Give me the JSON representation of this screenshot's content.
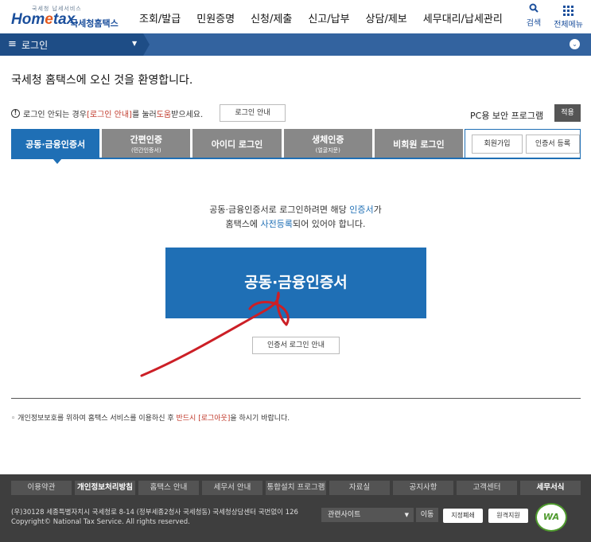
{
  "header": {
    "logo_tagline": "국세청 납세서비스",
    "logo_brand_a": "Hom",
    "logo_brand_e": "e",
    "logo_brand_b": "tax.",
    "logo_brand_kr": "국세청홈택스",
    "nav": [
      "조회/발급",
      "민원증명",
      "신청/제출",
      "신고/납부",
      "상담/제보",
      "세무대리/납세관리"
    ],
    "search_label": "검색",
    "allmenu_label": "전체메뉴"
  },
  "breadcrumb": {
    "title": "로그인"
  },
  "welcome": "국세청 홈택스에 오신 것을 환영합니다.",
  "notice": {
    "text_a": "로그인 안되는 경우 ",
    "text_red": "[로그인 안내]",
    "text_b": "를 눌러 ",
    "text_red2": "도움",
    "text_c": "받으세요.",
    "guide_button": "로그인 안내"
  },
  "pc_security": {
    "label": "PC용 보안 프로그램",
    "apply": "적용"
  },
  "tabs": [
    {
      "label": "공동·금융인증서",
      "sub": ""
    },
    {
      "label": "간편인증",
      "sub": "(민간인증서)"
    },
    {
      "label": "아이디 로그인",
      "sub": ""
    },
    {
      "label": "생체인증",
      "sub": "(얼굴지문)"
    },
    {
      "label": "비회원 로그인",
      "sub": ""
    }
  ],
  "side_buttons": {
    "signup": "회원가입",
    "cert_register": "인증서 등록"
  },
  "desc": {
    "line1_a": "공동·금융인증서로 로그인하려면 해당 ",
    "line1_blue": "인증서",
    "line1_b": "가",
    "line2_a": "홈택스에 ",
    "line2_blue": "사전등록",
    "line2_b": "되어 있어야 합니다."
  },
  "cert_button": "공동·금융인증서",
  "cert_guide": "인증서 로그인 안내",
  "privacy": {
    "a": "개인정보보호를 위하여 홈택스 서비스를 이용하신 후 ",
    "red": "반드시 [로그아웃]",
    "b": "을 하시기 바랍니다."
  },
  "footer": {
    "nav": [
      "이용약관",
      "개인정보처리방침",
      "홈택스 안내",
      "세무서 안내",
      "통합설치 프로그램",
      "자료실",
      "공지사항",
      "고객센터",
      "세무서식"
    ],
    "addr1": "(우)30128 세종특별자치시 국세청로 8-14 (정부세종2청사 국세청동) 국세청상담센터 국번없이 126",
    "addr2": "Copyright© National Tax Service. All rights reserved.",
    "related": "관련사이트",
    "go": "이동",
    "badge1": "지정폐쇄",
    "badge2": "원격지원",
    "wa": "WA"
  },
  "colors": {
    "primary": "#1f6fb5",
    "nav_bar": "#33639f",
    "footer_bg": "#3e3e3e",
    "scribble": "#cc1f26"
  }
}
